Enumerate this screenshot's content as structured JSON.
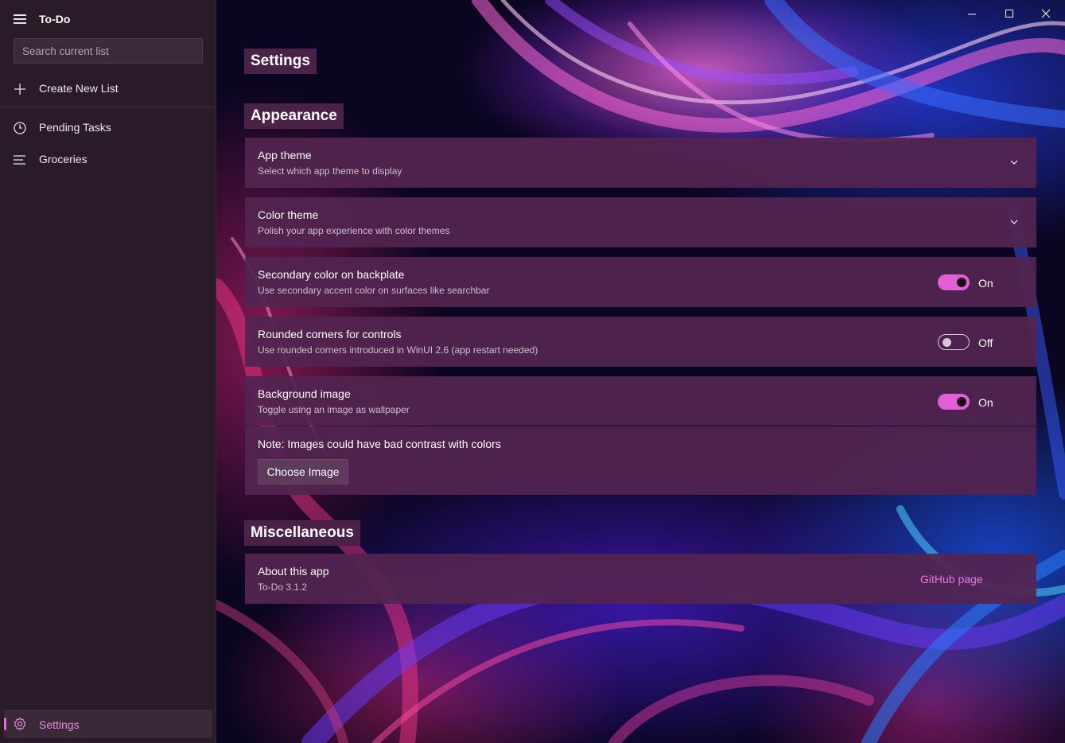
{
  "app": {
    "title": "To-Do"
  },
  "sidebar": {
    "search_placeholder": "Search current list",
    "create_label": "Create New List",
    "items": [
      {
        "label": "Pending Tasks",
        "icon": "clock-icon"
      },
      {
        "label": "Groceries",
        "icon": "list-icon"
      }
    ],
    "settings_label": "Settings"
  },
  "main": {
    "page_title": "Settings",
    "appearance_heading": "Appearance",
    "misc_heading": "Miscellaneous",
    "app_theme": {
      "title": "App theme",
      "subtitle": "Select which app theme to display"
    },
    "color_theme": {
      "title": "Color theme",
      "subtitle": "Polish your app experience with color themes"
    },
    "secondary_color": {
      "title": "Secondary color on backplate",
      "subtitle": "Use secondary accent color on surfaces like searchbar",
      "state": "On"
    },
    "rounded_corners": {
      "title": "Rounded corners for controls",
      "subtitle": "Use rounded corners introduced in WinUI 2.6 (app restart needed)",
      "state": "Off"
    },
    "background_image": {
      "title": "Background image",
      "subtitle": "Toggle using an image as wallpaper",
      "state": "On"
    },
    "note": "Note: Images could have bad contrast with colors",
    "choose_image_label": "Choose Image",
    "about": {
      "title": "About this app",
      "subtitle": "To-Do 3.1.2",
      "link_label": "GitHub page"
    }
  },
  "colors": {
    "accent": "#e25fd8",
    "sidebar_bg": "#2a1b28",
    "card_bg": "#522450"
  }
}
